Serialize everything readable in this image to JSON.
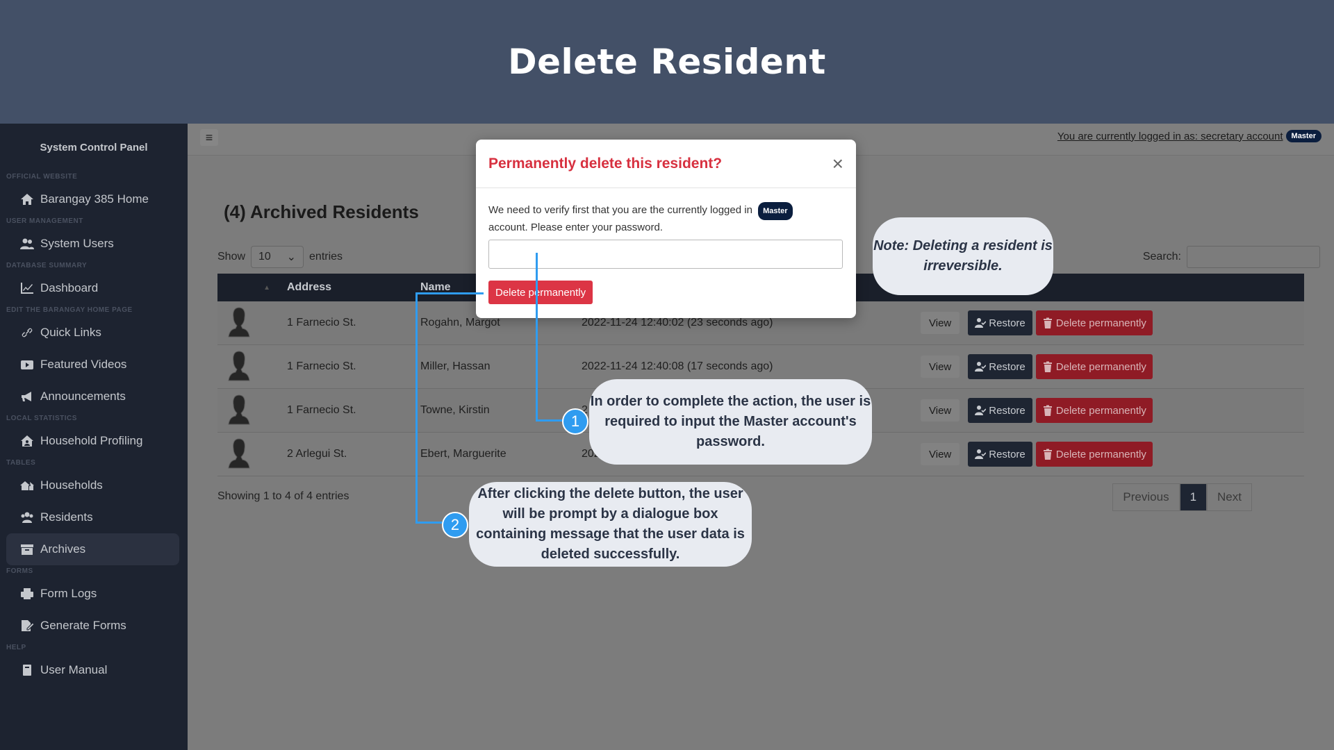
{
  "banner": {
    "title": "Delete Resident"
  },
  "sidebar": {
    "brand": "System Control Panel",
    "sections": {
      "official": "OFFICIAL WEBSITE",
      "user_mgmt": "USER MANAGEMENT",
      "db_summary": "DATABASE SUMMARY",
      "edit_home": "EDIT THE BARANGAY HOME PAGE",
      "local_stats": "LOCAL STATISTICS",
      "tables": "TABLES",
      "forms": "FORMS",
      "help": "HELP"
    },
    "items": {
      "home": "Barangay 385 Home",
      "system_users": "System Users",
      "dashboard": "Dashboard",
      "quick_links": "Quick Links",
      "featured_videos": "Featured Videos",
      "announcements": "Announcements",
      "household_profiling": "Household Profiling",
      "households": "Households",
      "residents": "Residents",
      "archives": "Archives",
      "form_logs": "Form Logs",
      "generate_forms": "Generate Forms",
      "user_manual": "User Manual"
    }
  },
  "topbar": {
    "menu_icon": "≡",
    "logged_in_text": "You are currently logged in as: secretary account",
    "badge": "Master"
  },
  "main": {
    "title": "(4) Archived Residents",
    "show_label": "Show",
    "entries_label": "entries",
    "page_size": "10",
    "search_label": "Search:",
    "columns": {
      "address": "Address",
      "name": "Name"
    },
    "rows": [
      {
        "address": "1 Farnecio St.",
        "name": "Rogahn, Margot",
        "date": "2022-11-24 12:40:02 (23 seconds ago)"
      },
      {
        "address": "1 Farnecio St.",
        "name": "Miller, Hassan",
        "date": "2022-11-24 12:40:08 (17 seconds ago)"
      },
      {
        "address": "1 Farnecio St.",
        "name": "Towne, Kirstin",
        "date": "2"
      },
      {
        "address": "2 Arlegui St.",
        "name": "Ebert, Marguerite",
        "date": "202"
      }
    ],
    "actions": {
      "view": "View",
      "restore": "Restore",
      "delete": "Delete permanently"
    },
    "showing": "Showing 1 to 4 of 4 entries",
    "pager": {
      "previous": "Previous",
      "current": "1",
      "next": "Next"
    }
  },
  "modal": {
    "title": "Permanently delete this resident?",
    "close": "×",
    "message_before": "We need to verify first that you are the currently logged in",
    "badge": "Master",
    "message_after": "account. Please enter your password.",
    "button": "Delete permanently"
  },
  "callouts": {
    "note": "Note: Deleting a resident is irreversible.",
    "step1_number": "1",
    "step1": "In order to complete the action, the user is required to input the Master account's password.",
    "step2_number": "2",
    "step2": "After clicking the delete button, the user will be prompt by a dialogue box containing message that the user data is deleted successfully."
  },
  "colors": {
    "banner": "#435067",
    "sidebar": "#1d2330",
    "danger": "#dc3545",
    "callout_accent": "#2f9cf0"
  }
}
